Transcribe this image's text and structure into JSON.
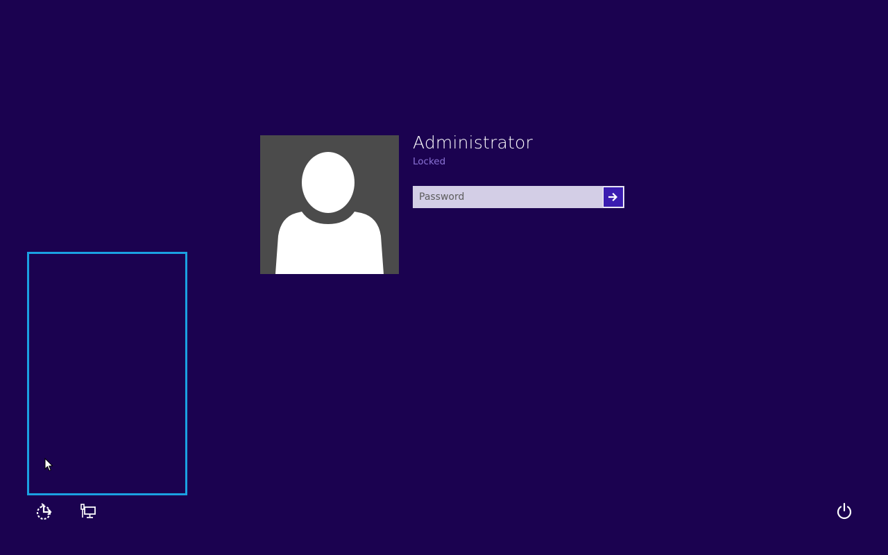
{
  "user": {
    "name": "Administrator",
    "status": "Locked"
  },
  "password": {
    "placeholder": "Password",
    "value": ""
  },
  "icons": {
    "submit": "arrow-right-icon",
    "ease_of_access": "ease-of-access-icon",
    "network": "network-icon",
    "power": "power-icon"
  },
  "colors": {
    "background": "#1b0250",
    "accent": "#3a1cb0",
    "focus_border": "#1ba1e2",
    "status_text": "#8b73d6"
  }
}
